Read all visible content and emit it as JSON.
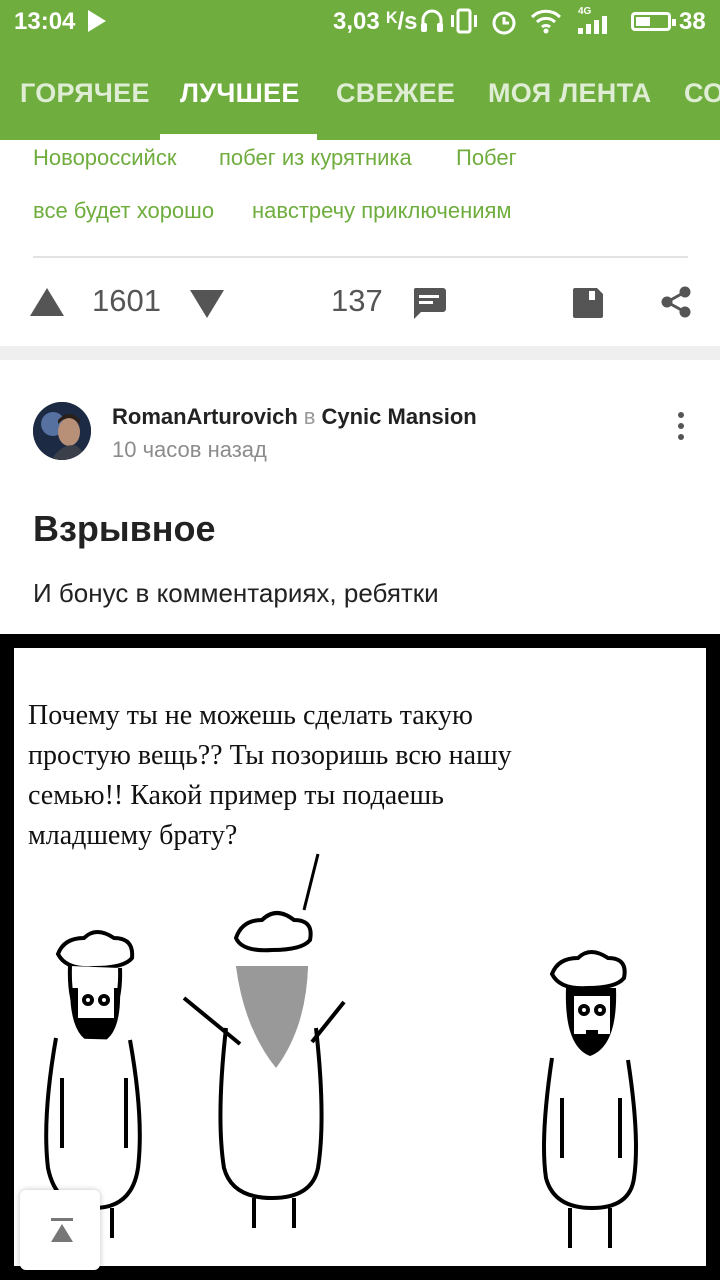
{
  "status_bar": {
    "time": "13:04",
    "net_speed": "3,03 ᴷ/s",
    "network": "4G",
    "battery": "38",
    "icons": [
      "play-icon",
      "headphones-icon",
      "vibrate-icon",
      "alarm-icon",
      "wifi-icon",
      "signal-icon",
      "battery-icon"
    ]
  },
  "tabs": [
    {
      "label": "ГОРЯЧЕЕ",
      "active": false
    },
    {
      "label": "ЛУЧШЕЕ",
      "active": true
    },
    {
      "label": "СВЕЖЕЕ",
      "active": false
    },
    {
      "label": "МОЯ ЛЕНТА",
      "active": false
    },
    {
      "label": "СО",
      "active": false
    }
  ],
  "prev_post": {
    "tags": [
      "Новороссийск",
      "побег из курятника",
      "Побег",
      "все будет хорошо",
      "навстречу приключениям"
    ],
    "rating": "1601",
    "comments": "137",
    "icons": [
      "upvote-icon",
      "downvote-icon",
      "comment-icon",
      "save-icon",
      "share-icon"
    ]
  },
  "post": {
    "author": "RomanArturovich",
    "in_word": "в",
    "community": "Cynic Mansion",
    "time_ago": "10 часов назад",
    "title": "Взрывное",
    "text": "И бонус в комментариях, ребятки",
    "comic": {
      "speech_lines": [
        "Почему ты не можешь сделать такую",
        "простую вещь?? Ты позоришь всю нашу",
        "семью!! Какой пример ты подаешь",
        "младшему брату?"
      ]
    }
  },
  "colors": {
    "brand_green": "#6fad3e",
    "tag_green": "#6fad3e",
    "text_dark": "#222222",
    "muted": "#8c8c8c"
  }
}
